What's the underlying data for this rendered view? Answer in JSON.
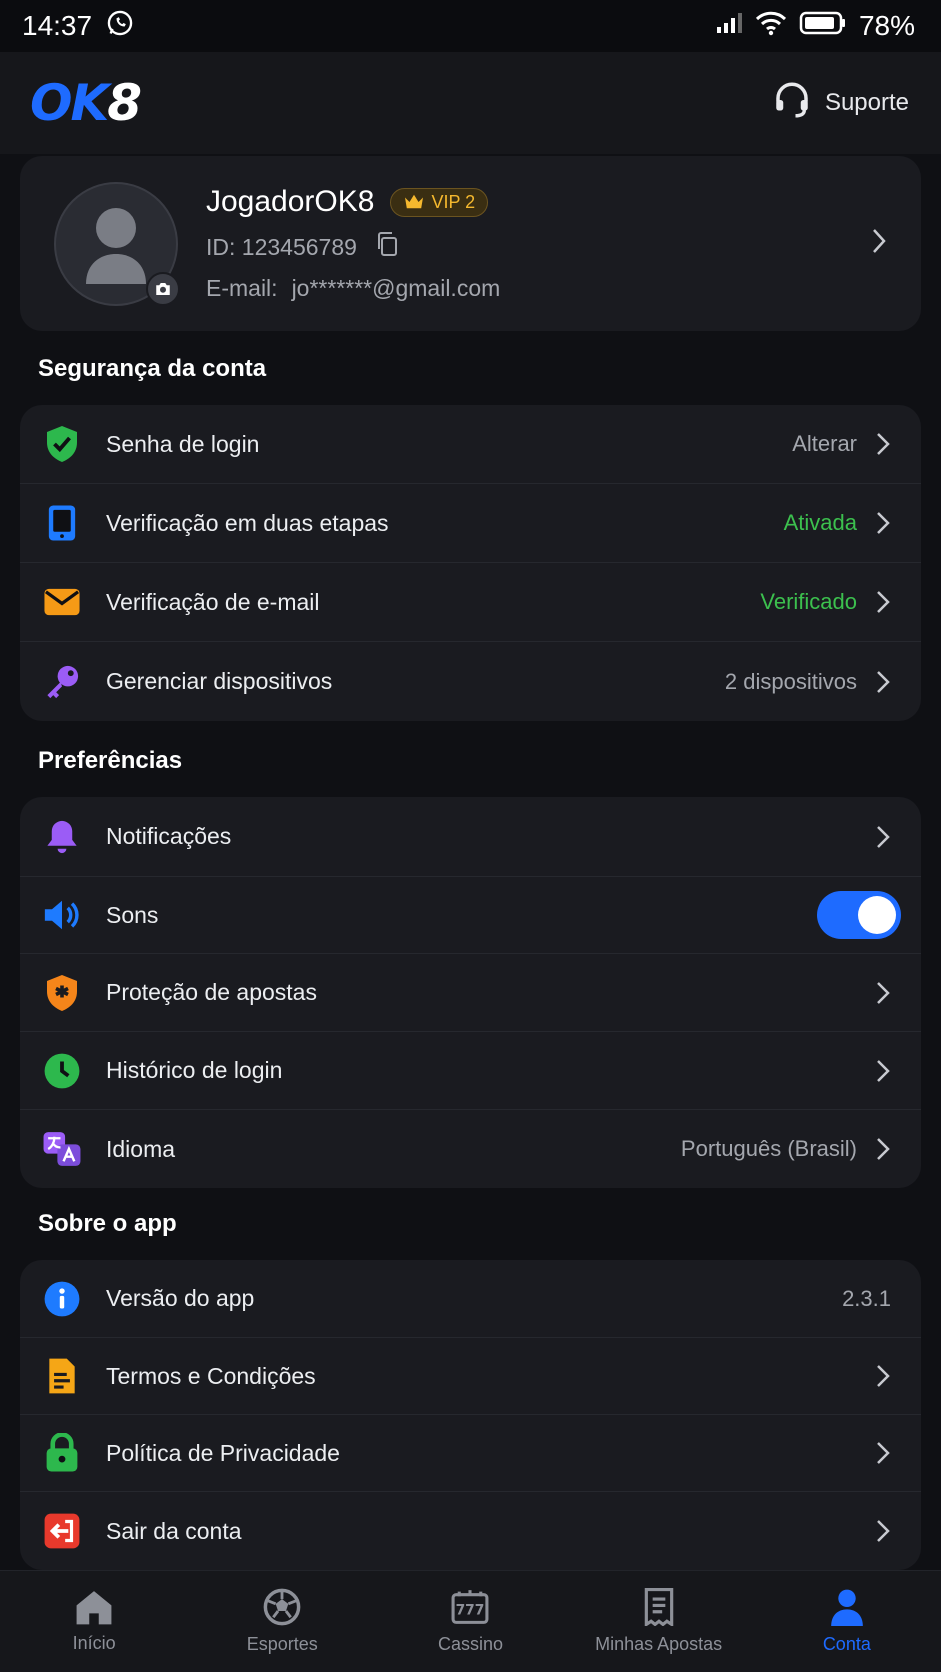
{
  "status_bar": {
    "time": "14:37",
    "battery": "78%"
  },
  "header": {
    "logo_ok": "OK",
    "logo_8": "8",
    "support_label": "Suporte"
  },
  "profile": {
    "username": "JogadorOK8",
    "vip": "VIP 2",
    "id_label": "ID:",
    "id_value": "123456789",
    "email_label": "E-mail:",
    "email_value": "jo*******@gmail.com"
  },
  "sections": {
    "security": {
      "title": "Segurança da conta",
      "items": [
        {
          "label": "Senha de login",
          "value": "Alterar"
        },
        {
          "label": "Verificação em duas etapas",
          "value": "Ativada"
        },
        {
          "label": "Verificação de e-mail",
          "value": "Verificado"
        },
        {
          "label": "Gerenciar dispositivos",
          "value": "2 dispositivos"
        }
      ]
    },
    "preferences": {
      "title": "Preferências",
      "items": [
        {
          "label": "Notificações"
        },
        {
          "label": "Sons",
          "toggle_on": true
        },
        {
          "label": "Proteção de apostas"
        },
        {
          "label": "Histórico de login"
        },
        {
          "label": "Idioma",
          "value": "Português (Brasil)"
        }
      ]
    },
    "about": {
      "title": "Sobre o app",
      "items": [
        {
          "label": "Versão do app",
          "value": "2.3.1"
        },
        {
          "label": "Termos e Condições"
        },
        {
          "label": "Política de Privacidade"
        },
        {
          "label": "Sair da conta"
        }
      ]
    }
  },
  "bottom_nav": {
    "items": [
      {
        "label": "Início",
        "icon": "home-icon"
      },
      {
        "label": "Esportes",
        "icon": "soccer-ball-icon"
      },
      {
        "label": "Cassino",
        "icon": "slot-machine-icon"
      },
      {
        "label": "Minhas Apostas",
        "icon": "receipt-icon"
      },
      {
        "label": "Conta",
        "icon": "user-icon",
        "active": true
      }
    ]
  },
  "colors": {
    "accent": "#1e6bff",
    "success": "#3cc04e",
    "vip": "#f5b82e",
    "background": "#0f1014",
    "card": "#1a1b20"
  }
}
